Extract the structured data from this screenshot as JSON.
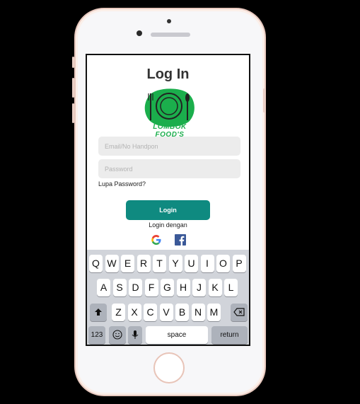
{
  "screen": {
    "title": "Log In",
    "logo_text": "LOMBOK FOOD'S",
    "email_placeholder": "Email/No Handpon",
    "password_placeholder": "Password",
    "forgot_label": "Lupa Password?",
    "login_label": "Login",
    "login_with_label": "Login dengan",
    "social": [
      "google-icon",
      "facebook-icon"
    ]
  },
  "keyboard": {
    "row1": [
      "Q",
      "W",
      "E",
      "R",
      "T",
      "Y",
      "U",
      "I",
      "O",
      "P"
    ],
    "row2": [
      "A",
      "S",
      "D",
      "F",
      "G",
      "H",
      "J",
      "K",
      "L"
    ],
    "row3": [
      "Z",
      "X",
      "C",
      "V",
      "B",
      "N",
      "M"
    ],
    "numbers_label": "123",
    "space_label": "space",
    "return_label": "return"
  },
  "colors": {
    "accent": "#0f8a80",
    "logo_green": "#1bae4c"
  }
}
